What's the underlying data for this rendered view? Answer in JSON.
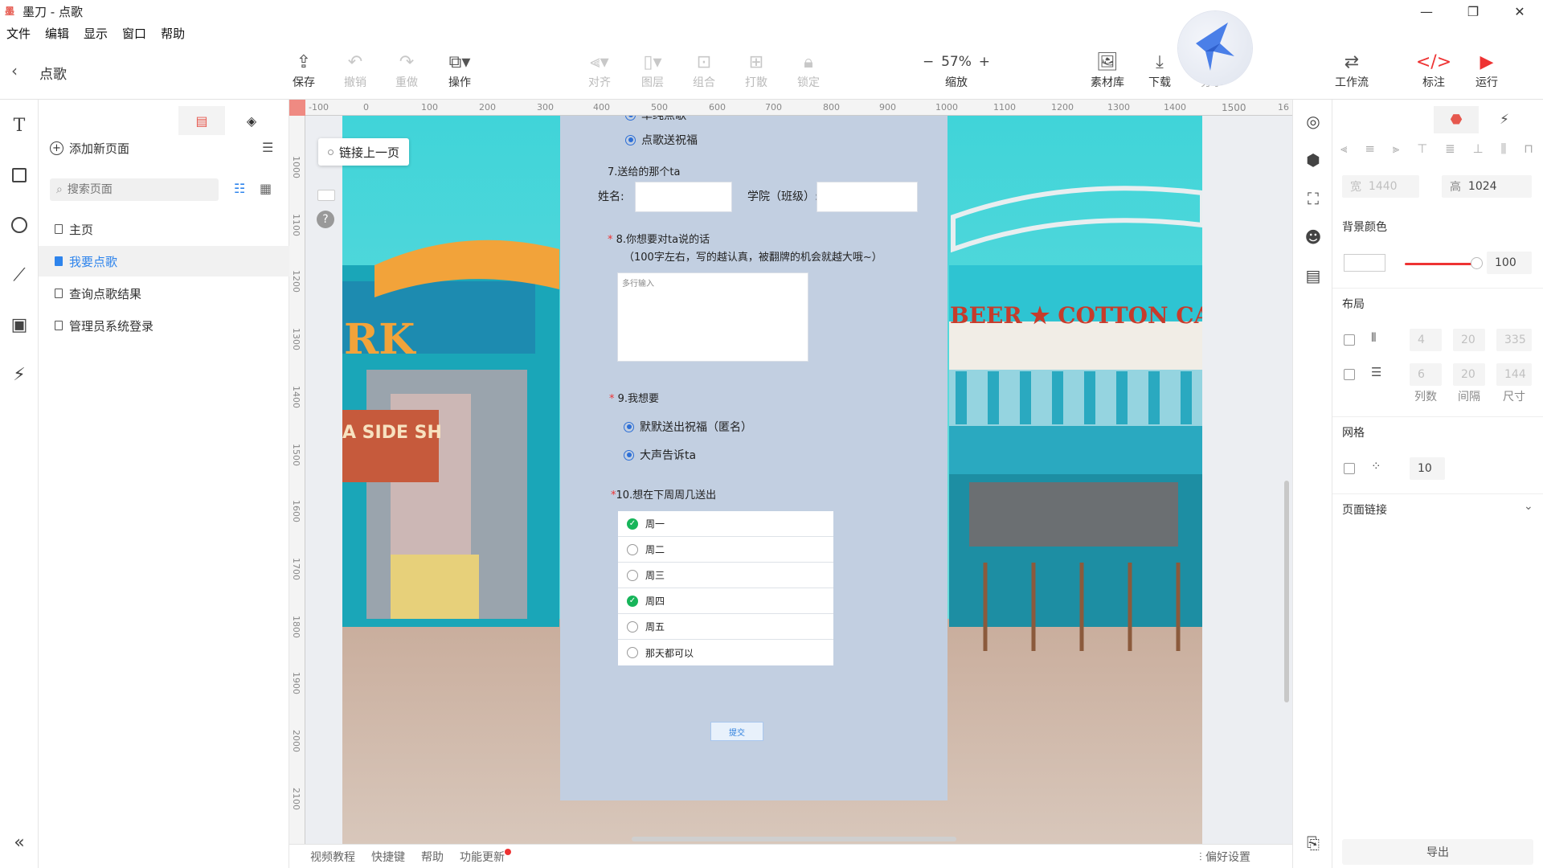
{
  "app": {
    "title": "墨刀 - 点歌",
    "logo": "墨"
  },
  "menu": [
    "文件",
    "编辑",
    "显示",
    "窗口",
    "帮助"
  ],
  "toolbar": {
    "page_name": "点歌",
    "buttons": [
      {
        "label": "保存",
        "icon": "cloud-upload-icon"
      },
      {
        "label": "撤销",
        "icon": "undo-icon"
      },
      {
        "label": "重做",
        "icon": "redo-icon"
      },
      {
        "label": "操作",
        "icon": "copy-icon"
      },
      {
        "label": "对齐",
        "icon": "align-icon"
      },
      {
        "label": "图层",
        "icon": "layer-icon"
      },
      {
        "label": "组合",
        "icon": "group-icon"
      },
      {
        "label": "打散",
        "icon": "ungroup-icon"
      },
      {
        "label": "锁定",
        "icon": "lock-icon"
      },
      {
        "label": "素材库",
        "icon": "image-icon"
      },
      {
        "label": "下载",
        "icon": "download-icon"
      },
      {
        "label": "分享",
        "icon": "share-icon"
      },
      {
        "label": "工作流",
        "icon": "workflow-icon"
      },
      {
        "label": "标注",
        "icon": "code-icon"
      },
      {
        "label": "运行",
        "icon": "play-icon"
      }
    ],
    "zoom": {
      "value": "57%",
      "label": "缩放",
      "minus": "−",
      "plus": "+"
    }
  },
  "pages_panel": {
    "add_page": "添加新页面",
    "search_placeholder": "搜索页面",
    "pages": [
      "主页",
      "我要点歌",
      "查询点歌结果",
      "管理员系统登录"
    ],
    "selected": "我要点歌"
  },
  "canvas": {
    "link_chip": "链接上一页",
    "ruler_h": [
      "-100",
      "0",
      "100",
      "200",
      "300",
      "400",
      "500",
      "600",
      "700",
      "800",
      "900",
      "1000",
      "1100",
      "1200",
      "1300",
      "1400",
      "1500",
      "16"
    ],
    "ruler_v": [
      "1000",
      "1100",
      "1200",
      "1300",
      "1400",
      "1500",
      "1600",
      "1700",
      "1800",
      "1900",
      "2000",
      "2100"
    ],
    "photo_sign": "BEER ★ COTTON CANDY ★ ICE CREAM",
    "photo_sign2": "RK",
    "photo_sign3": "A SIDE SH"
  },
  "form": {
    "opt_a": "单纯点歌",
    "opt_b": "点歌送祝福",
    "q7": "7.送给的那个ta",
    "name_label": "姓名:",
    "college_label": "学院（班级）:",
    "q8": "8.你想要对ta说的话",
    "q8_hint": "（100字左右，写的越认真，被翻牌的机会就越大哦~）",
    "textarea_placeholder": "多行输入",
    "q9": "9.我想要",
    "q9_opt1": "默默送出祝福（匿名）",
    "q9_opt2": "大声告诉ta",
    "q10": "10.想在下周周几送出",
    "days": [
      {
        "label": "周一",
        "checked": true
      },
      {
        "label": "周二",
        "checked": false
      },
      {
        "label": "周三",
        "checked": false
      },
      {
        "label": "周四",
        "checked": true
      },
      {
        "label": "周五",
        "checked": false
      },
      {
        "label": "那天都可以",
        "checked": false
      }
    ],
    "submit": "提交",
    "required_mark": "*"
  },
  "bottom": {
    "links": [
      "视频教程",
      "快捷键",
      "帮助",
      "功能更新"
    ],
    "prefs": "偏好设置"
  },
  "props": {
    "width": "1440",
    "width_label": "宽",
    "height": "1024",
    "height_label": "高",
    "bg_label": "背景颜色",
    "opacity": "100",
    "layout_label": "布局",
    "cols_vals": [
      "4",
      "20",
      "335"
    ],
    "rows_vals": [
      "6",
      "20",
      "144"
    ],
    "layout_cols": [
      "列数",
      "间隔",
      "尺寸"
    ],
    "grid_label": "网格",
    "grid_value": "10",
    "page_link": "页面链接",
    "export": "导出"
  },
  "colors": {
    "accent": "#e6584e",
    "link": "#2e84ec",
    "form_bg": "#c2cfe1",
    "check": "#17b55a"
  }
}
